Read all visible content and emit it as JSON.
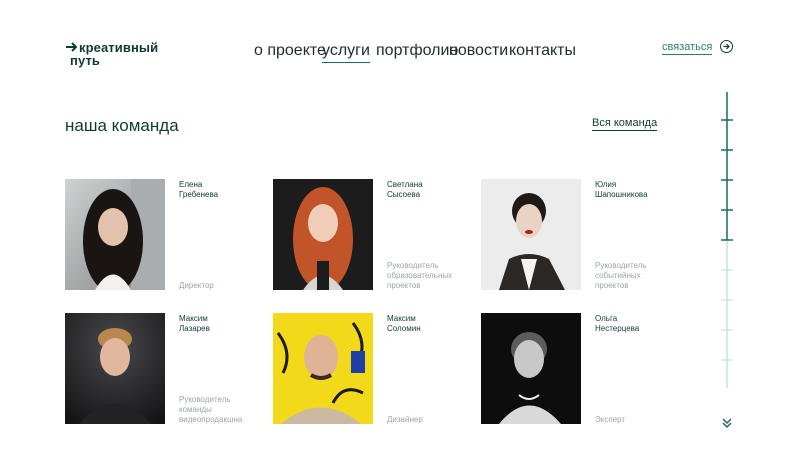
{
  "logo": {
    "line1": "креативный",
    "line2": "путь"
  },
  "nav": [
    {
      "label": "о проекте",
      "active": false
    },
    {
      "label": "услуги",
      "active": true
    },
    {
      "label": "портфолио",
      "active": false
    },
    {
      "label": "новости",
      "active": false
    },
    {
      "label": "контакты",
      "active": false
    }
  ],
  "header": {
    "contact_label": "связаться",
    "contact_icon": "arrow-right-circle-icon"
  },
  "team": {
    "title": "наша команда",
    "all_link": "Вся команда",
    "members": [
      {
        "first": "Елена",
        "last": "Гребенева",
        "role": "Директор"
      },
      {
        "first": "Светлана",
        "last": "Сысоева",
        "role": "Руководитель образовательных проектов"
      },
      {
        "first": "Юлия",
        "last": "Шапошникова",
        "role": "Руководитель событийных проектов"
      },
      {
        "first": "Максим",
        "last": "Лазарев",
        "role": "Руководитель команды видеопродакшна"
      },
      {
        "first": "Максим",
        "last": "Соломин",
        "role": "Дизайнер"
      },
      {
        "first": "Ольга",
        "last": "Нестерцева",
        "role": "Эксперт"
      }
    ]
  },
  "colors": {
    "brand": "#0f3b36",
    "accent": "#2d7d6c",
    "muted": "#9aa6a3",
    "timeline_light": "#bfe8d8"
  },
  "scroll": {
    "icon": "double-chevron-down-icon"
  }
}
